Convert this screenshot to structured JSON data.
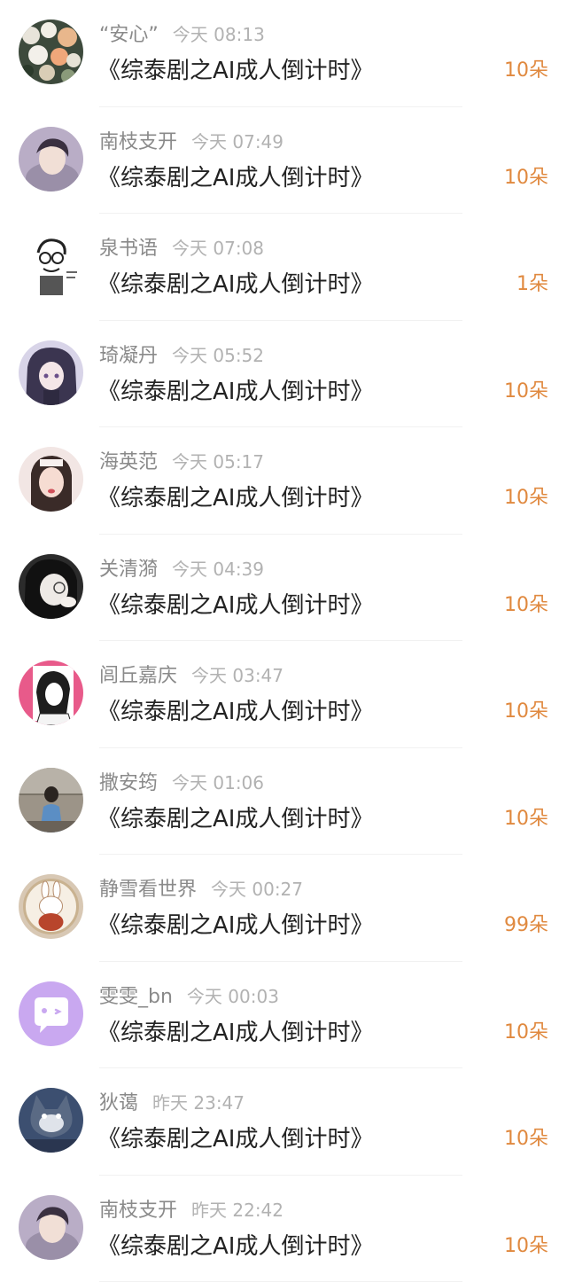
{
  "gifts": [
    {
      "name": "“安心”",
      "time": "今天 08:13",
      "title": "《综泰剧之AI成人倒计时》",
      "count": "10朵",
      "avatar_icon": "bouquet-avatar-icon"
    },
    {
      "name": "南枝支开",
      "time": "今天 07:49",
      "title": "《综泰剧之AI成人倒计时》",
      "count": "10朵",
      "avatar_icon": "portrait-avatar-icon"
    },
    {
      "name": "泉书语",
      "time": "今天 07:08",
      "title": "《综泰剧之AI成人倒计时》",
      "count": "1朵",
      "avatar_icon": "sketch-avatar-icon"
    },
    {
      "name": "琦凝丹",
      "time": "今天 05:52",
      "title": "《综泰剧之AI成人倒计时》",
      "count": "10朵",
      "avatar_icon": "anime-girl-avatar-icon"
    },
    {
      "name": "海英范",
      "time": "今天 05:17",
      "title": "《综泰剧之AI成人倒计时》",
      "count": "10朵",
      "avatar_icon": "girl-photo-avatar-icon"
    },
    {
      "name": "关清漪",
      "time": "今天 04:39",
      "title": "《综泰剧之AI成人倒计时》",
      "count": "10朵",
      "avatar_icon": "dark-hair-avatar-icon"
    },
    {
      "name": "闾丘嘉庆",
      "time": "今天 03:47",
      "title": "《综泰剧之AI成人倒计时》",
      "count": "10朵",
      "avatar_icon": "pink-anime-avatar-icon"
    },
    {
      "name": "撒安筠",
      "time": "今天 01:06",
      "title": "《综泰剧之AI成人倒计时》",
      "count": "10朵",
      "avatar_icon": "street-photo-avatar-icon"
    },
    {
      "name": "静雪看世界",
      "time": "今天 00:27",
      "title": "《综泰剧之AI成人倒计时》",
      "count": "99朵",
      "avatar_icon": "rabbit-plate-avatar-icon"
    },
    {
      "name": "雯雯_bn",
      "time": "今天 00:03",
      "title": "《综泰剧之AI成人倒计时》",
      "count": "10朵",
      "avatar_icon": "chat-bubble-avatar-icon"
    },
    {
      "name": "狄蔼",
      "time": "昨天 23:47",
      "title": "《综泰剧之AI成人倒计时》",
      "count": "10朵",
      "avatar_icon": "cat-cartoon-avatar-icon"
    },
    {
      "name": "南枝支开",
      "time": "昨天 22:42",
      "title": "《综泰剧之AI成人倒计时》",
      "count": "10朵",
      "avatar_icon": "portrait-avatar-icon"
    }
  ],
  "colors": {
    "name": "#8a8a8a",
    "time": "#b2b2b2",
    "title": "#222222",
    "count": "#e0893f",
    "divider": "#f1f1f1",
    "chat_avatar_bg": "#c9a8f0"
  }
}
